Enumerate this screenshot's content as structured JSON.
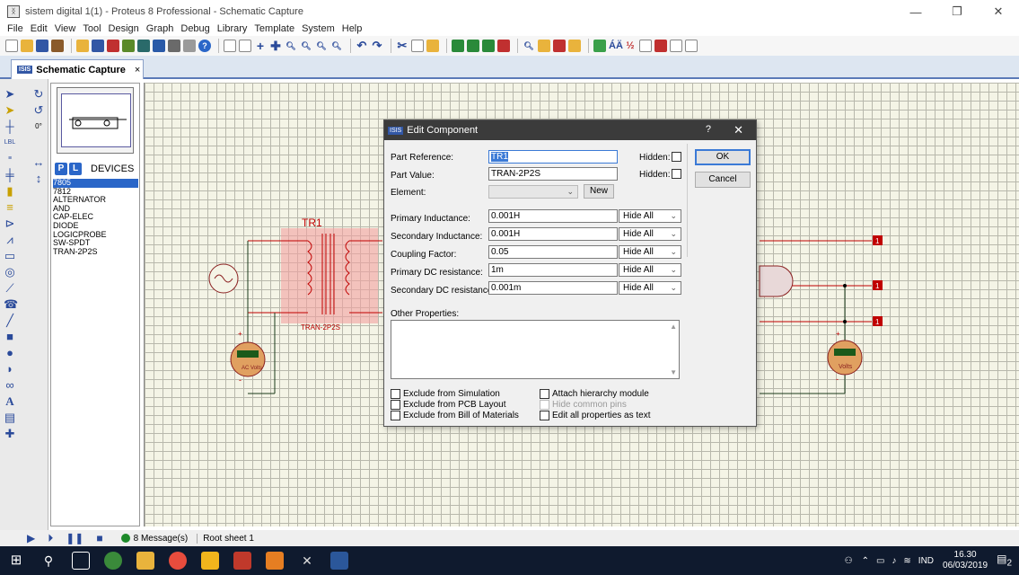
{
  "window": {
    "title": "sistem digital 1(1) - Proteus 8 Professional - Schematic Capture",
    "minimize": "—",
    "restore": "❐",
    "close": "✕"
  },
  "menu": [
    "File",
    "Edit",
    "View",
    "Tool",
    "Design",
    "Graph",
    "Debug",
    "Library",
    "Template",
    "System",
    "Help"
  ],
  "tab": {
    "label": "Schematic Capture",
    "close": "×",
    "badge": "ISIS"
  },
  "left_panel": {
    "rotation_value": "0°",
    "picker_p": "P",
    "picker_l": "L",
    "devices_label": "DEVICES",
    "devices": [
      "7805",
      "7812",
      "ALTERNATOR",
      "AND",
      "CAP-ELEC",
      "DIODE",
      "LOGICPROBE",
      "SW-SPDT",
      "TRAN-2P2S"
    ],
    "selected_device": "7805"
  },
  "schematic": {
    "tr_label": "TR1",
    "tr_part": "TRAN-2P2S",
    "meter_left": "AC Volts",
    "meter_right": "Volts",
    "probe_value": "1",
    "plus": "+",
    "minus": "-"
  },
  "dialog": {
    "title": "Edit Component",
    "badge": "ISIS",
    "help": "?",
    "close": "✕",
    "part_reference_label": "Part Reference:",
    "part_reference_value": "TR1",
    "part_value_label": "Part Value:",
    "part_value_value": "TRAN-2P2S",
    "element_label": "Element:",
    "hidden_label_1": "Hidden:",
    "hidden_label_2": "Hidden:",
    "new_button": "New",
    "ok_button": "OK",
    "cancel_button": "Cancel",
    "properties": [
      {
        "label": "Primary Inductance:",
        "value": "0.001H",
        "hide": "Hide All"
      },
      {
        "label": "Secondary Inductance:",
        "value": "0.001H",
        "hide": "Hide All"
      },
      {
        "label": "Coupling Factor:",
        "value": "0.05",
        "hide": "Hide All"
      },
      {
        "label": "Primary DC resistance:",
        "value": "1m",
        "hide": "Hide All"
      },
      {
        "label": "Secondary DC resistance:",
        "value": "0.001m",
        "hide": "Hide All"
      }
    ],
    "other_properties_label": "Other Properties:",
    "checkboxes_left": [
      "Exclude from Simulation",
      "Exclude from PCB Layout",
      "Exclude from Bill of Materials"
    ],
    "checkboxes_right": [
      "Attach hierarchy module",
      "Hide common pins",
      "Edit all properties as text"
    ]
  },
  "statusbar": {
    "messages": "8 Message(s)",
    "sheet": "Root sheet 1"
  },
  "taskbar": {
    "language": "IND",
    "time": "16.30",
    "date": "06/03/2019",
    "notification_count": "2"
  },
  "colors": {
    "wire": "#c00000",
    "selection": "#f2a0a0",
    "dialog_title": "#3b3b3b",
    "accent": "#3b7ad6",
    "taskbar": "#0f1a2e"
  }
}
